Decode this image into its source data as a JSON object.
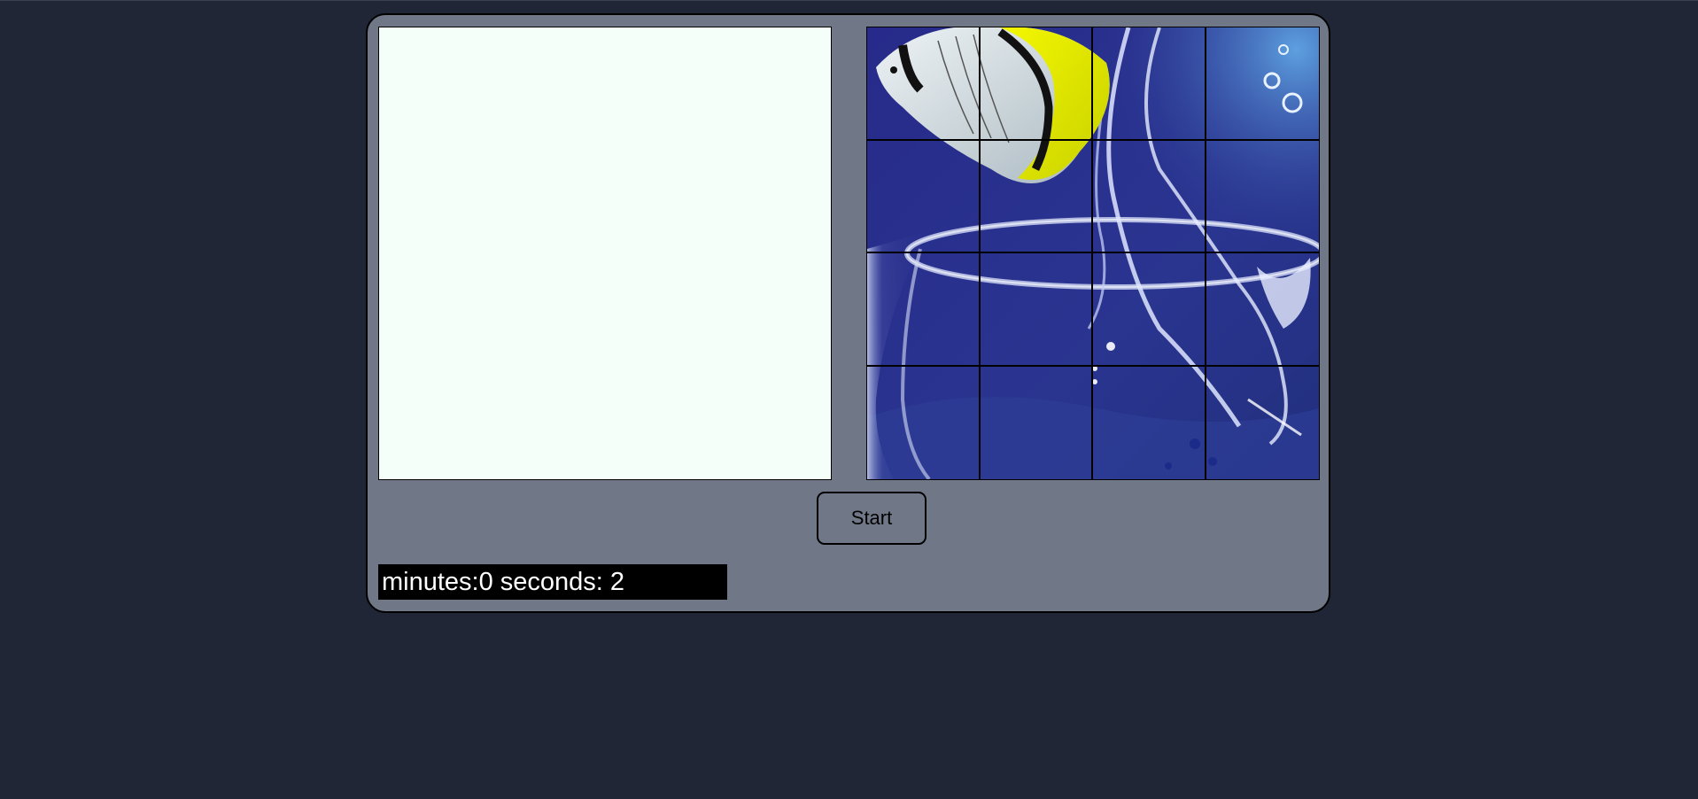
{
  "game": {
    "start_label": "Start",
    "timer_text": "minutes:0 seconds: 2",
    "timer": {
      "minutes": 0,
      "seconds": 2
    },
    "grid": {
      "rows": 4,
      "cols": 4
    },
    "image_subject": "butterflyfish-over-fishbowl"
  },
  "colors": {
    "page_background": "#212636",
    "container_background": "#707888",
    "empty_board": "#f3fff8",
    "timer_background": "#000000",
    "timer_text": "#ffffff"
  }
}
